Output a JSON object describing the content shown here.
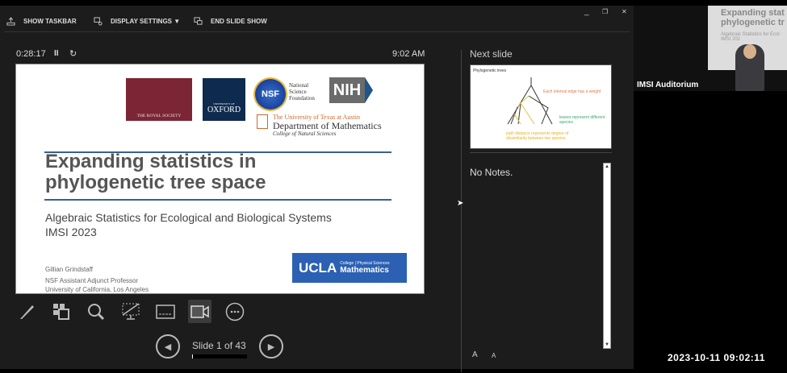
{
  "toolbar": {
    "show_taskbar": "SHOW TASKBAR",
    "display_settings": "DISPLAY SETTINGS ▼",
    "end_slide_show": "END SLIDE SHOW"
  },
  "window_controls": {
    "minimize": "_",
    "restore": "❐",
    "close": "✕"
  },
  "presenter": {
    "elapsed": "0:28:17",
    "clock": "9:02 AM",
    "pause_icon": "II",
    "reset_icon": "↻"
  },
  "slide": {
    "logos": {
      "royal_society": "THE ROYAL SOCIETY",
      "oxford_top": "UNIVERSITY OF",
      "oxford": "OXFORD",
      "nsf": "NSF",
      "nsf_text": "National Science Foundation",
      "nih": "NIH",
      "ut_line1": "The University of Texas at Austin",
      "ut_line2": "Department of Mathematics",
      "ut_line3": "College of Natural Sciences"
    },
    "title_line1": "Expanding statistics in",
    "title_line2": "phylogenetic tree space",
    "subtitle_line1": "Algebraic Statistics for Ecological and Biological Systems",
    "subtitle_line2": "IMSI 2023",
    "author": "Gillian Grindstaff",
    "position": "NSF Assistant Adjunct Professor",
    "affiliation": "University of California, Los Angeles",
    "ucla": "UCLA",
    "ucla_small": "College | Physical Sciences",
    "ucla_dept": "Mathematics"
  },
  "tools": [
    "pen",
    "see-all-slides",
    "zoom",
    "black-screen",
    "subtitles",
    "camera",
    "more-options"
  ],
  "nav": {
    "slide_label": "Slide 1 of 43",
    "current": 1,
    "total": 43,
    "progress_percent": 2
  },
  "next": {
    "label": "Next slide",
    "title": "Phylogenetic trees",
    "annotation1": "Each internal edge has a weight",
    "annotation2": "leaves represent different species",
    "annotation3": "path distance represents degree of dissimilarity between two species",
    "leaves": [
      "1",
      "2",
      "3",
      "4",
      "5",
      "6"
    ]
  },
  "notes": {
    "text": "No Notes.",
    "increase": "A",
    "decrease": "A"
  },
  "video": {
    "label": "IMSI Auditorium",
    "screen_line1": "Expanding stat",
    "screen_line2": "phylogenetic tr",
    "screen_line3": "Algebraic Statistics for Ecol",
    "screen_line4": "IMSI 202"
  },
  "timestamp": "2023-10-11  09:02:11",
  "colors": {
    "ucla_blue": "#2b60b3",
    "rule_blue": "#3a5f8e",
    "royal_red": "#7b2535",
    "oxford_blue": "#0e2a4e"
  }
}
